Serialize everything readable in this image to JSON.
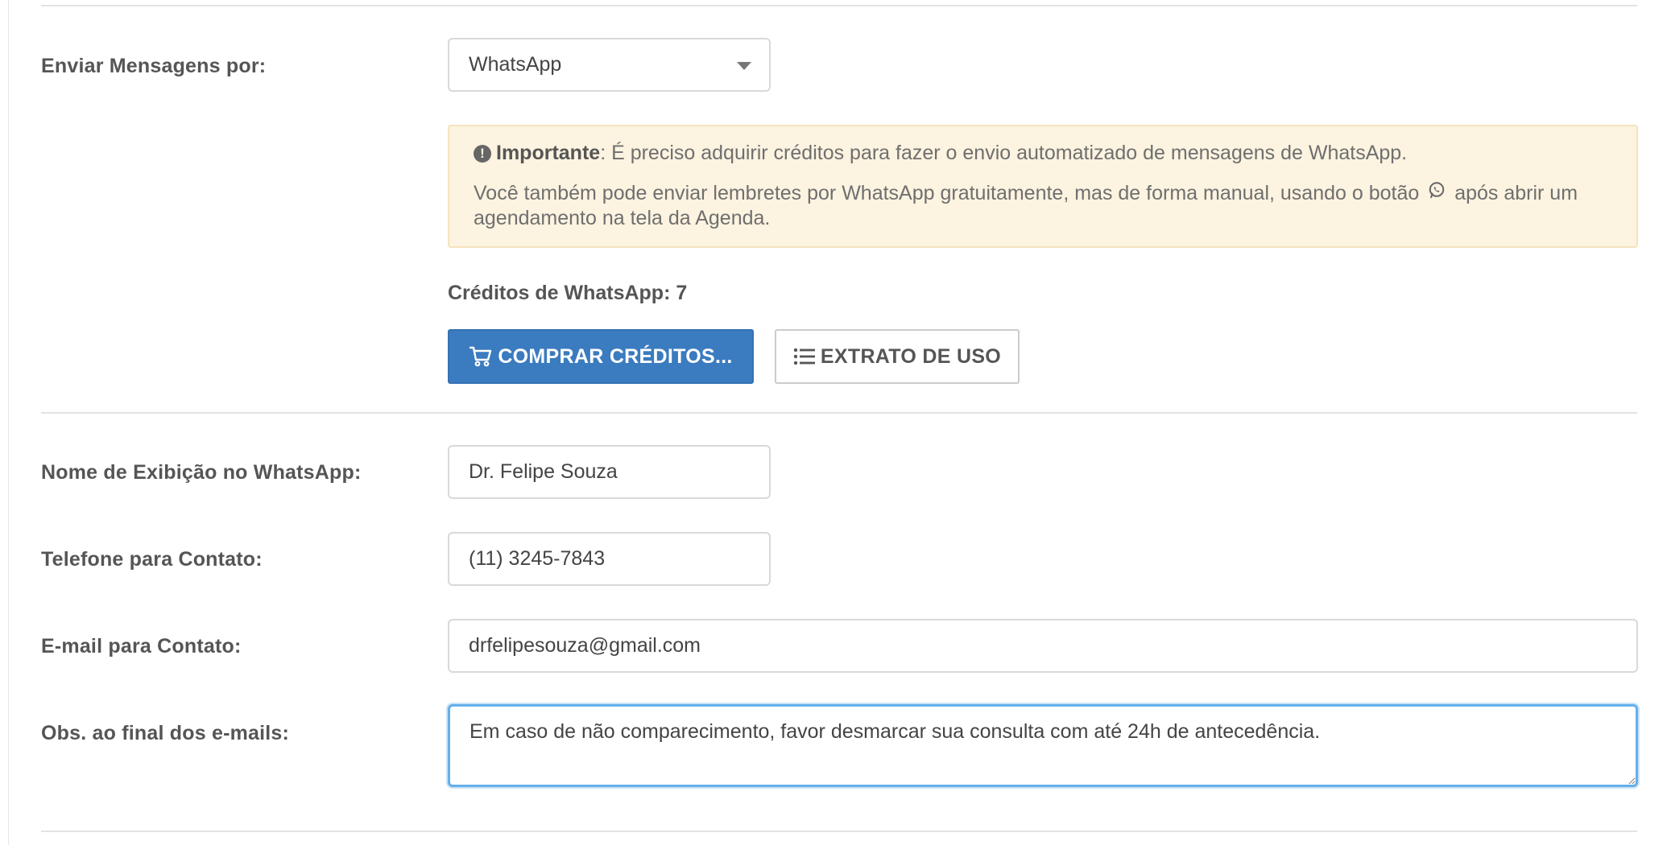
{
  "send_via": {
    "label": "Enviar Mensagens por:",
    "selected": "WhatsApp"
  },
  "alert": {
    "strong": "Importante",
    "text1": ": É preciso adquirir créditos para fazer o envio automatizado de mensagens de WhatsApp.",
    "text2_before": "Você também pode enviar lembretes por WhatsApp gratuitamente, mas de forma manual, usando o botão",
    "text2_after": "após abrir um agendamento na tela da Agenda."
  },
  "credits": {
    "label": "Créditos de WhatsApp: 7"
  },
  "buttons": {
    "buy": "COMPRAR CRÉDITOS...",
    "statement": "EXTRATO DE USO"
  },
  "fields": {
    "display_name": {
      "label": "Nome de Exibição no WhatsApp:",
      "value": "Dr. Felipe Souza"
    },
    "phone": {
      "label": "Telefone para Contato:",
      "value": "(11) 3245-7843"
    },
    "email": {
      "label": "E-mail para Contato:",
      "value": "drfelipesouza@gmail.com"
    },
    "footer_note": {
      "label": "Obs. ao final dos e-mails:",
      "value": "Em caso de não comparecimento, favor desmarcar sua consulta com até 24h de antecedência."
    }
  },
  "colors": {
    "primary": "#3b7bbf",
    "alert_bg": "#fcf3e0",
    "focus": "#66afe9"
  }
}
